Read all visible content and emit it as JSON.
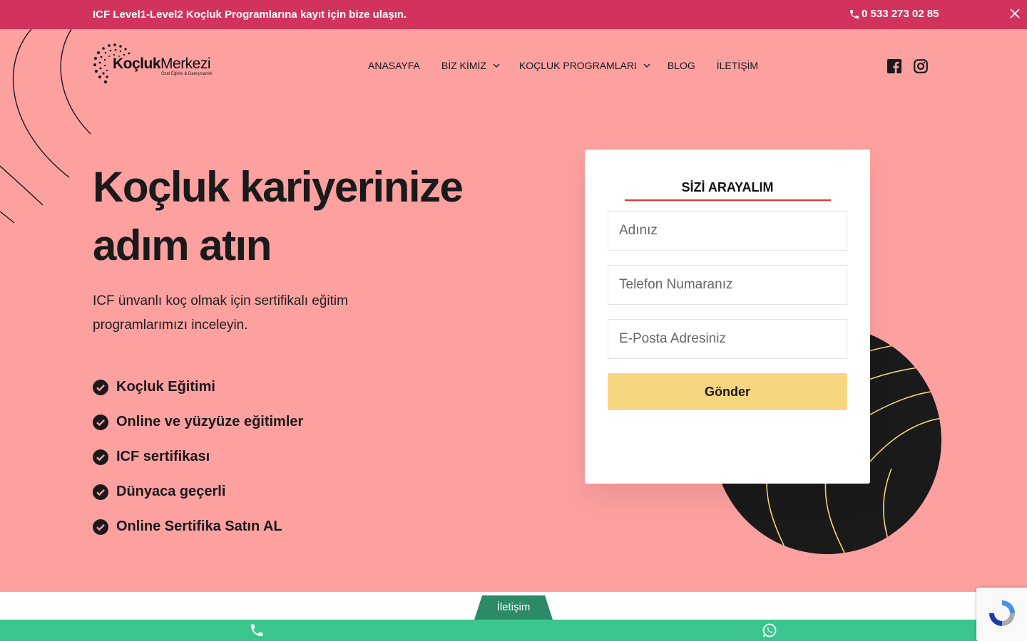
{
  "topbar": {
    "message": "ICF Level1-Level2 Koçluk Programlarına kayıt için bize ulaşın.",
    "phone": "0 533 273 02 85"
  },
  "logo": {
    "brand_bold": "Koçluk",
    "brand_light": "Merkezi",
    "tagline": "Özel Eğitim & Danışmanlık"
  },
  "nav": {
    "items": [
      {
        "label": "ANASAYFA",
        "has_dropdown": false
      },
      {
        "label": "BİZ KİMİZ",
        "has_dropdown": true
      },
      {
        "label": "KOÇLUK PROGRAMLARI",
        "has_dropdown": true
      },
      {
        "label": "BLOG",
        "has_dropdown": false
      },
      {
        "label": "İLETİŞİM",
        "has_dropdown": false
      }
    ]
  },
  "social": {
    "icons": [
      "facebook-icon",
      "instagram-icon"
    ]
  },
  "hero": {
    "title_line1": "Koçluk kariyerinize",
    "title_line2": "adım atın",
    "subtitle": "ICF ünvanlı koç olmak için sertifikalı eğitim programlarımızı inceleyin.",
    "features": [
      "Koçluk Eğitimi",
      "Online ve yüzyüze eğitimler",
      "ICF sertifikası",
      "Dünyaca geçerli",
      "Online Sertifika Satın AL"
    ]
  },
  "form": {
    "title": "SİZİ ARAYALIM",
    "name_placeholder": "Adınız",
    "phone_placeholder": "Telefon Numaranız",
    "email_placeholder": "E-Posta Adresiniz",
    "submit_label": "Gönder"
  },
  "bottom": {
    "contact_tab": "İletişim"
  },
  "colors": {
    "topbar": "#d1335d",
    "background": "#fda0a0",
    "accent_underline": "#e8322b",
    "button": "#f8d57f",
    "green_bar": "#3cc48f",
    "contact_tab": "#2c8a67"
  }
}
